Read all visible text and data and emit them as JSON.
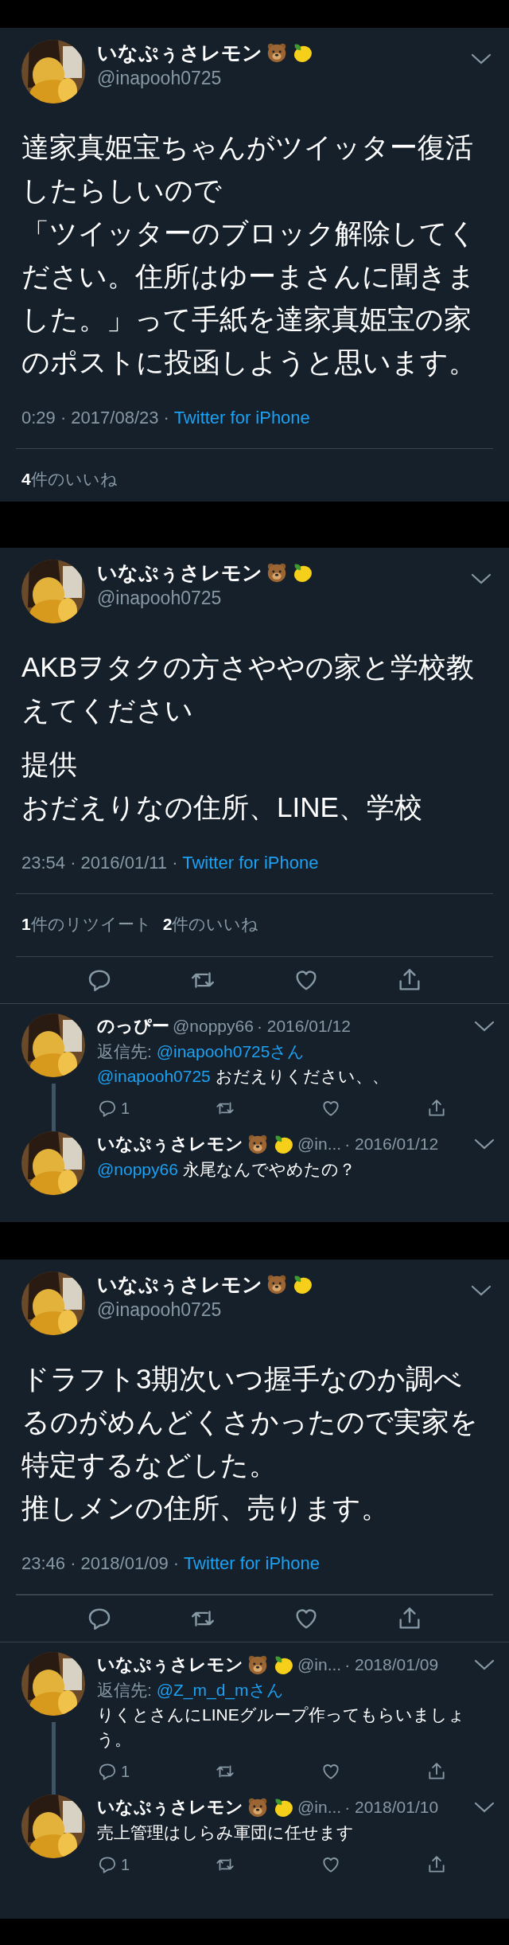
{
  "panels": [
    {
      "tweet": {
        "author": {
          "name": "いなぷぅさレモン",
          "emoji": true,
          "handle": "@inapooh0725"
        },
        "paragraphs": [
          [
            "達家真姫宝ちゃんがツイッター復活したらしいので",
            "「ツイッターのブロック解除してください。住所はゆーまさんに聞きました。」って手紙を達家真姫宝の家のポストに投函しようと思います。"
          ]
        ],
        "meta": "0:29 · 2017/08/23 ·",
        "source": "Twitter for iPhone",
        "stats": [
          {
            "count": "4",
            "label": "件のいいね"
          }
        ],
        "actions": false
      }
    },
    {
      "tweet": {
        "author": {
          "name": "いなぷぅさレモン",
          "emoji": true,
          "handle": "@inapooh0725"
        },
        "paragraphs": [
          [
            "AKBヲタクの方さややの家と学校教えてください"
          ],
          [
            "提供",
            "おだえりなの住所、LINE、学校"
          ]
        ],
        "meta": "23:54 · 2016/01/11 ·",
        "source": "Twitter for iPhone",
        "stats": [
          {
            "count": "1",
            "label": "件のリツイート"
          },
          {
            "count": "2",
            "label": "件のいいね"
          }
        ],
        "actions": true
      },
      "replies": [
        {
          "author": {
            "name": "のっぴー",
            "emoji": false,
            "handle": "@noppy66"
          },
          "date": "· 2016/01/12",
          "reply_to_label": "返信先:",
          "reply_to": "@inapooh0725さん",
          "mention": "@inapooh0725",
          "text": "おだえりください、、",
          "reply_count": "1",
          "thread": true,
          "actions": true
        },
        {
          "author": {
            "name": "いなぷぅさレモン",
            "emoji": true,
            "handle": "@in..."
          },
          "date": "· 2016/01/12",
          "mention": "@noppy66",
          "text": "永尾なんでやめたの？",
          "thread": false,
          "actions": false
        }
      ]
    },
    {
      "tweet": {
        "author": {
          "name": "いなぷぅさレモン",
          "emoji": true,
          "handle": "@inapooh0725"
        },
        "paragraphs": [
          [
            "ドラフト3期次いつ握手なのか調べるのがめんどくさかったので実家を特定するなどした。",
            "推しメンの住所、売ります。"
          ]
        ],
        "meta": "23:46 · 2018/01/09 ·",
        "source": "Twitter for iPhone",
        "actions": true
      },
      "replies": [
        {
          "author": {
            "name": "いなぷぅさレモン",
            "emoji": true,
            "handle": "@in..."
          },
          "date": "· 2018/01/09",
          "reply_to_label": "返信先:",
          "reply_to": "@Z_m_d_mさん",
          "text": "りくとさんにLINEグループ作ってもらいましょう。",
          "reply_count": "1",
          "thread": true,
          "actions": true
        },
        {
          "author": {
            "name": "いなぷぅさレモン",
            "emoji": true,
            "handle": "@in..."
          },
          "date": "· 2018/01/10",
          "text": "売上管理はしらみ軍団に任せます",
          "reply_count": "1",
          "thread": false,
          "actions": true
        }
      ]
    }
  ]
}
